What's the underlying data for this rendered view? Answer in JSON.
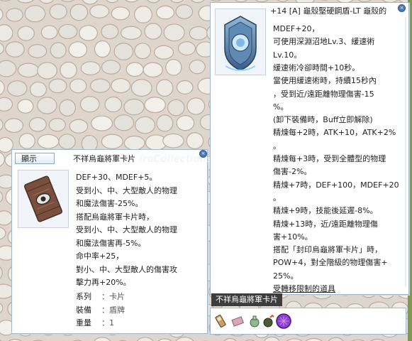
{
  "card_window": {
    "show_button": "顯示",
    "title": "不祥烏龜將軍卡片",
    "watermark": "iroCollections",
    "description": [
      "DEF+30、MDEF+5。",
      "受到小、中、大型敵人的物理",
      "和魔法傷害-25%。",
      "搭配烏龜將軍卡片時，",
      "受到小、中、大型敵人的物理",
      "和魔法傷害再-5%。",
      "命中率+25，",
      "對小、中、大型敵人的傷害攻",
      "擊力再+20%。"
    ],
    "attributes": [
      {
        "label": "系列",
        "value": "卡片"
      },
      {
        "label": "裝備",
        "value": "盾牌"
      },
      {
        "label": "重量",
        "value": "1"
      }
    ]
  },
  "shield_window": {
    "title": "+14 [A] 龜殼堅硬鋼盾-LT 龜殼的",
    "description": [
      "MDEF+20，",
      "可使用深淵沼地Lv.3、緩速術",
      "Lv.10。",
      "緩速術冷卻時間+10秒。",
      "當使用緩速術時，持續15秒內",
      "，受到近/遠距離物理傷害-15",
      "%。",
      "(卸下裝備時，Buff立即解除)",
      "精煉每+2時，ATK+10，ATK+2%",
      "。",
      "精煉每+3時，受到全體型的物理",
      "傷害-2%。",
      "精煉+7時，DEF+100，MDEF+20",
      "。",
      "精煉+9時，技能後延遲-8%。",
      "精煉+13時，近/遠距離物理傷",
      "害+10%。",
      "搭配「封印烏龜將軍卡片」時，",
      "POW+4，對全階級的物理傷害+",
      "25%。",
      "受轉移限制的道具"
    ]
  },
  "tooltip": {
    "text": "不祥烏龜將軍卡片"
  },
  "taskbar": {
    "icons": [
      "card-icon",
      "ticket-icon",
      "potion-icon",
      "grenade-icon",
      "orb-icon"
    ]
  }
}
